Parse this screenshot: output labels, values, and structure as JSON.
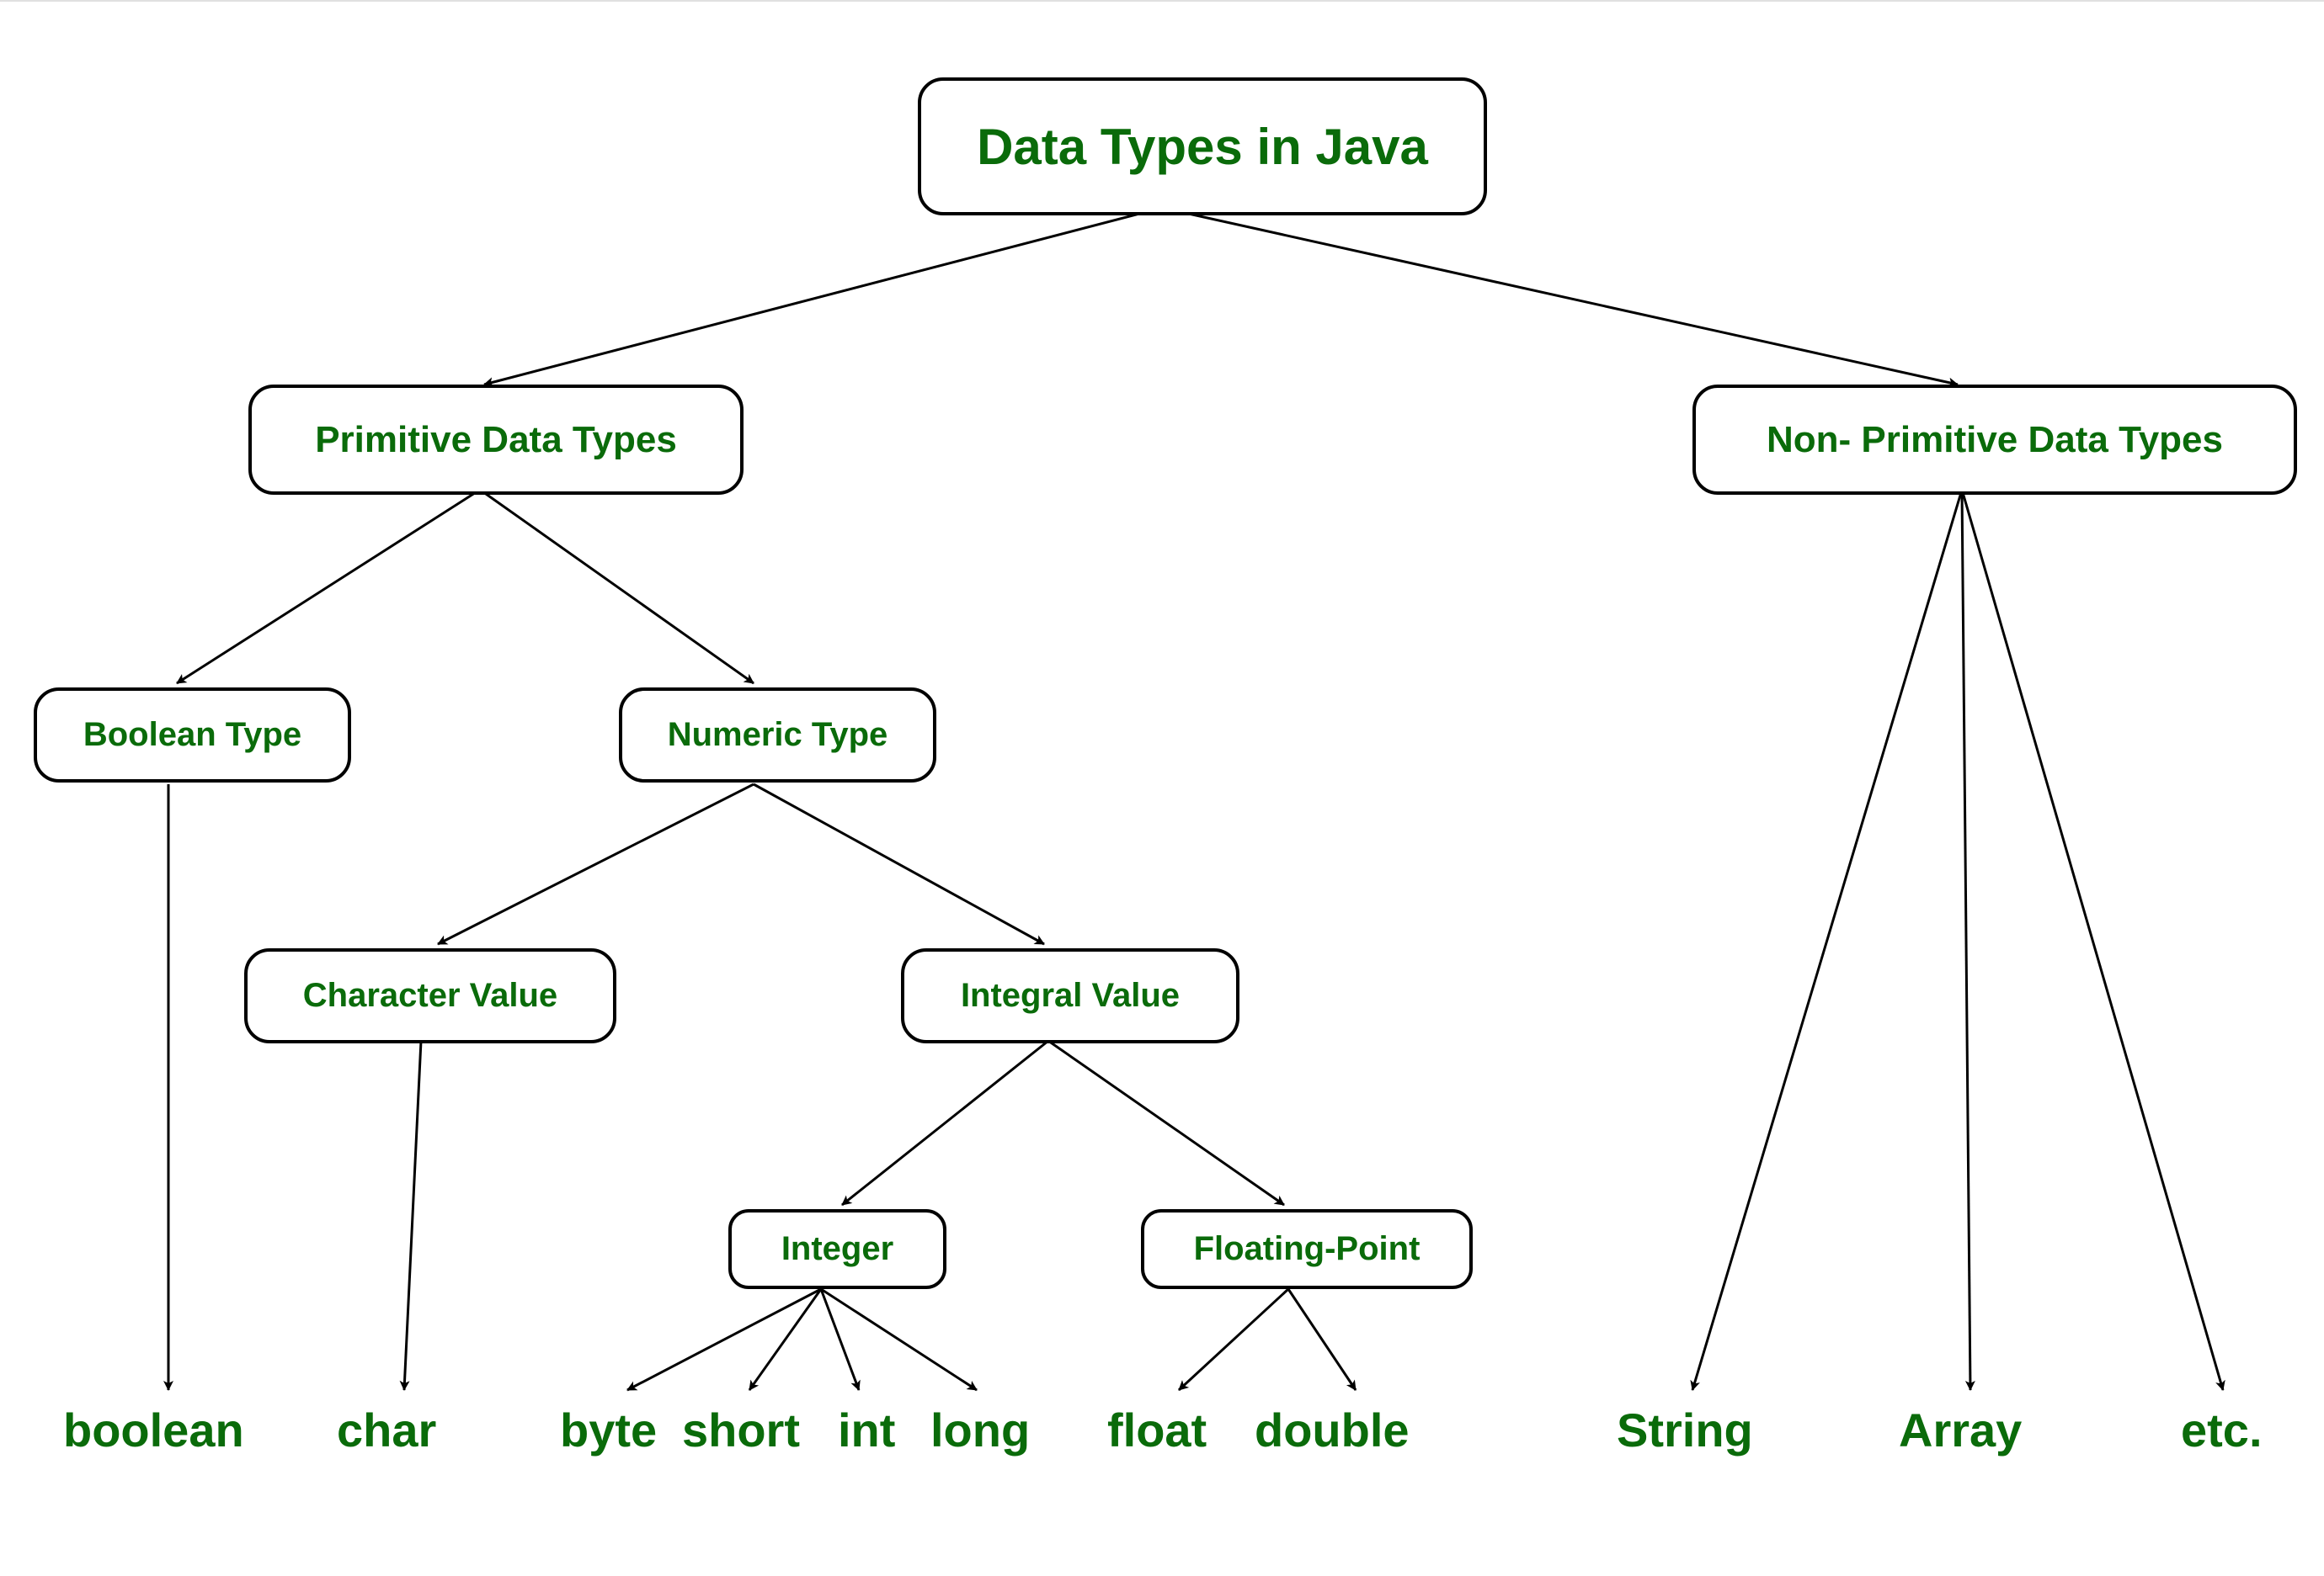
{
  "diagram": {
    "root": "Data Types in Java",
    "primitive": "Primitive Data Types",
    "nonprimitive": "Non- Primitive Data Types",
    "booleanType": "Boolean Type",
    "numericType": "Numeric Type",
    "characterValue": "Character Value",
    "integralValue": "Integral Value",
    "integer": "Integer",
    "floatingPoint": "Floating-Point",
    "leafs": {
      "boolean": "boolean",
      "char": "char",
      "byte": "byte",
      "short": "short",
      "int": "int",
      "long": "long",
      "float": "float",
      "double": "double",
      "string": "String",
      "array": "Array",
      "etc": "etc."
    }
  }
}
